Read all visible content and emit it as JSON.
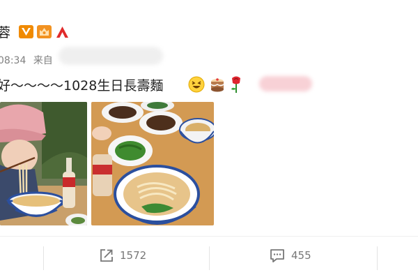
{
  "post": {
    "author_fragment": "蓉",
    "time_fragment": "08:34",
    "source_label": "来自",
    "text": "好～～～～1028生日長壽麵"
  },
  "badges": [
    {
      "icon": "verified-v-icon",
      "color": "#f08a00"
    },
    {
      "icon": "crown-hand-icon",
      "color": "#f29221"
    },
    {
      "icon": "a-logo-icon",
      "color": "#e02b2b"
    }
  ],
  "emojis": [
    "grinning-squint-emoji",
    "cake-emoji",
    "rose-emoji"
  ],
  "actions": {
    "share_count": "1572",
    "comment_count": "455"
  }
}
